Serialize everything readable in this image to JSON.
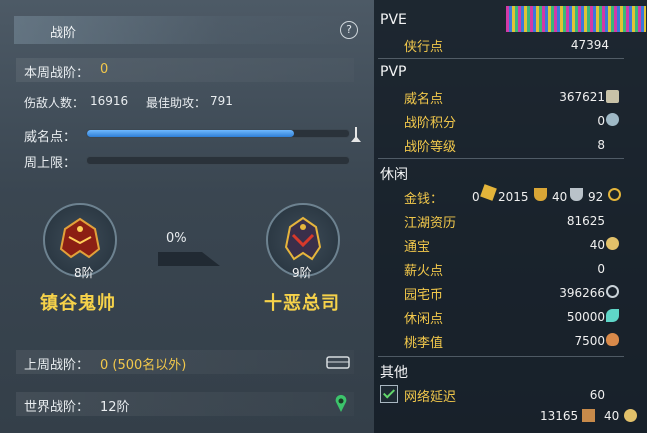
{
  "left": {
    "title": "战阶",
    "help": "?",
    "weekly_rank_label": "本周战阶：",
    "weekly_rank_value": "0",
    "kills_label": "伤敌人数：",
    "kills_value": "16916",
    "assist_label": "最佳助攻：",
    "assist_value": "791",
    "prestige_label": "威名点：",
    "prestige_progress": 0.79,
    "weekly_cap_label": "周上限：",
    "weekly_cap_progress": 0,
    "current_rank": {
      "level": "8阶",
      "name": "镇谷鬼帅"
    },
    "next_rank": {
      "level": "9阶",
      "name": "十恶总司"
    },
    "progress_text": "0%",
    "last_week_label": "上周战阶：",
    "last_week_value": "0 (500名以外)",
    "world_label": "世界战阶：",
    "world_value": "12阶"
  },
  "right": {
    "pve": {
      "header": "PVE",
      "items": [
        {
          "label": "侠行点",
          "value": "47394"
        }
      ]
    },
    "pvp": {
      "header": "PVP",
      "items": [
        {
          "label": "威名点",
          "value": "367621"
        },
        {
          "label": "战阶积分",
          "value": "0"
        },
        {
          "label": "战阶等级",
          "value": "8"
        }
      ]
    },
    "leisure": {
      "header": "休闲",
      "money": {
        "label": "金钱：",
        "v1": "0",
        "v2": "2015",
        "v3": "40",
        "v4": "92"
      },
      "items": [
        {
          "label": "江湖资历",
          "value": "81625"
        },
        {
          "label": "通宝",
          "value": "40"
        },
        {
          "label": "薪火点",
          "value": "0"
        },
        {
          "label": "园宅币",
          "value": "396266"
        },
        {
          "label": "休闲点",
          "value": "50000"
        },
        {
          "label": "桃李值",
          "value": "7500"
        }
      ]
    },
    "other": {
      "header": "其他",
      "items": [
        {
          "label": "网络延迟",
          "value": "60"
        }
      ]
    },
    "bottom": {
      "v1": "13165",
      "v2": "40"
    }
  },
  "colors": {
    "gold": "#f2c84b",
    "bar_fill": "#2f7fd6",
    "bg": "#3a4651"
  }
}
